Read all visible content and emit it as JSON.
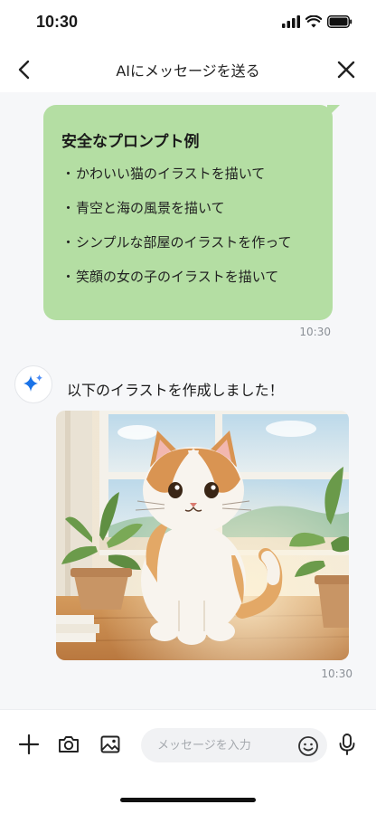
{
  "status_bar": {
    "time": "10:30"
  },
  "header": {
    "title": "AIにメッセージを送る"
  },
  "user_message": {
    "title": "安全なプロンプト例",
    "items": [
      "かわいい猫のイラストを描いて",
      "青空と海の風景を描いて",
      "シンプルな部屋のイラストを作って",
      "笑顔の女の子のイラストを描いて"
    ],
    "bullet": "・",
    "time": "10:30"
  },
  "ai_message": {
    "text": "以下のイラストを作成しました！",
    "time": "10:30"
  },
  "input_bar": {
    "placeholder": "メッセージを入力"
  },
  "colors": {
    "bubble": "#b4dea3",
    "accent": "#1a73e8",
    "chat_bg": "#f6f7f9"
  },
  "icons": [
    "back-icon",
    "close-icon",
    "sparkle-icon",
    "plus-icon",
    "camera-icon",
    "image-icon",
    "emoji-icon",
    "mic-icon"
  ]
}
